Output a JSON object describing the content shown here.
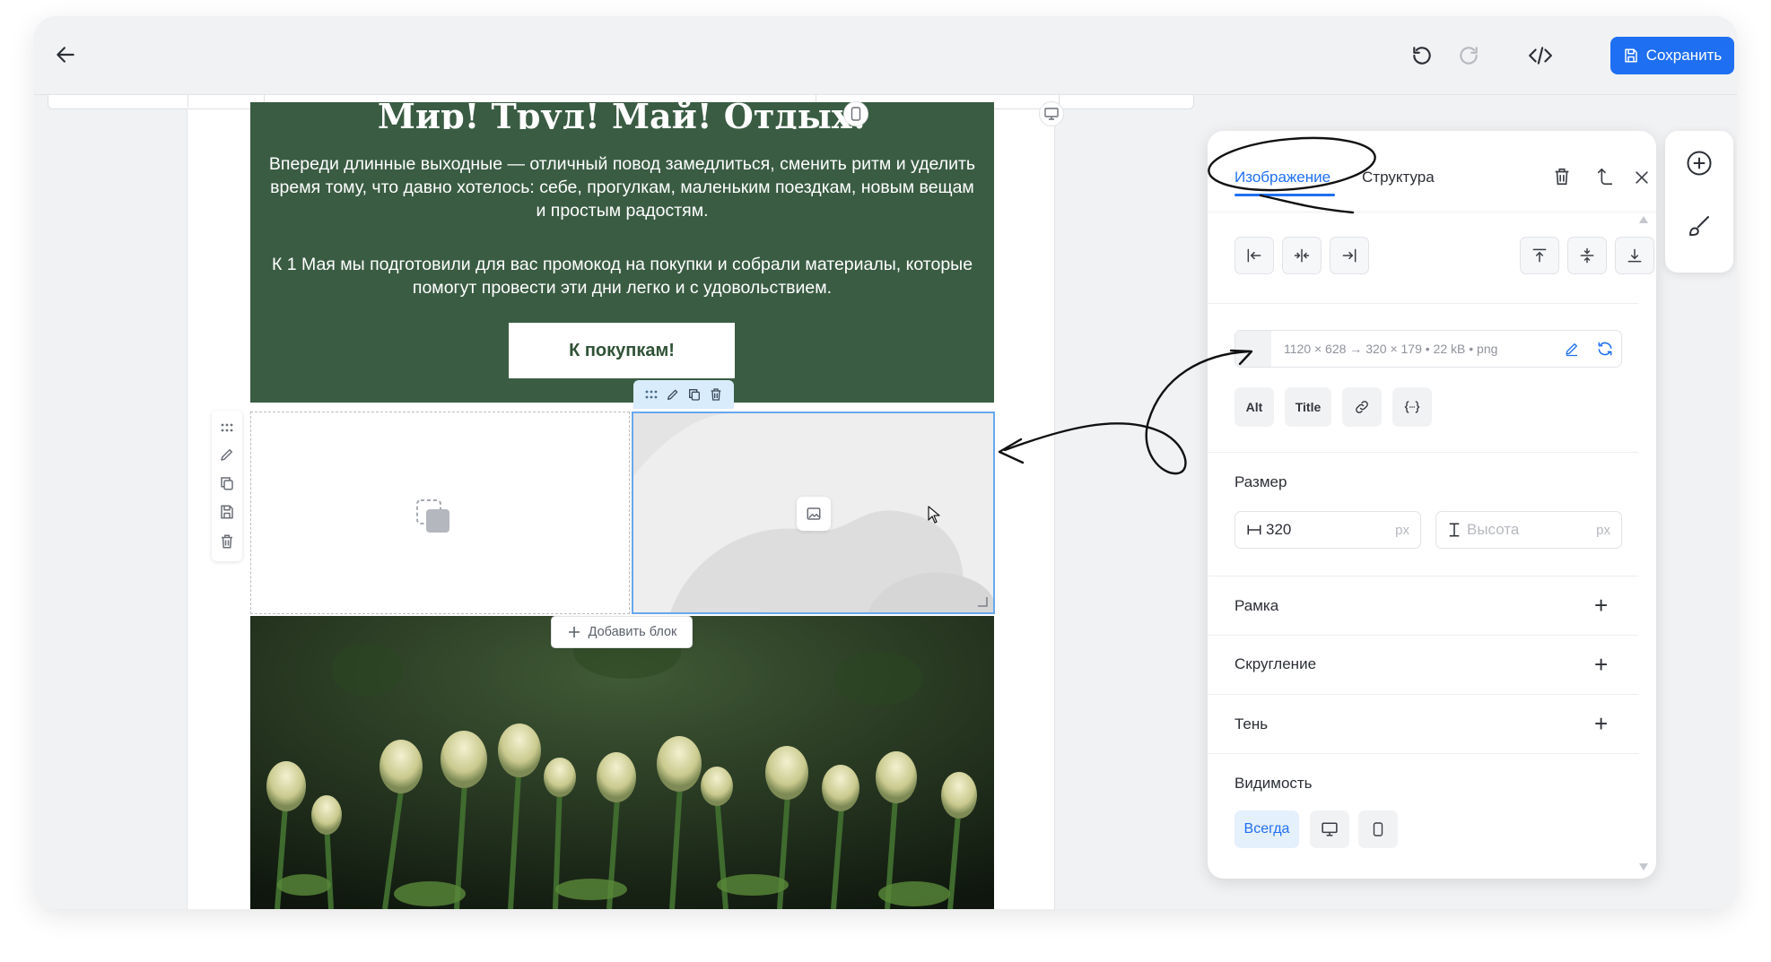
{
  "toolbar": {
    "back_icon": "arrow-left-icon",
    "undo_icon": "undo-icon",
    "redo_icon": "redo-icon",
    "code_icon": "code-icon",
    "save_label": "Сохранить"
  },
  "email": {
    "title": "Мир! Труд! Май! Отдых!",
    "paragraph1": "Впереди длинные выходные — отличный повод замедлиться, сменить ритм и уделить время тому, что давно хотелось: себе, прогулкам, маленьким поездкам, новым вещам и простым радостям.",
    "paragraph2": "К 1 Мая мы подготовили для вас промокод на покупки и собрали материалы, которые помогут провести эти дни легко и с удовольствием.",
    "cta_label": "К покупкам!",
    "add_block_label": "Добавить блок"
  },
  "panel": {
    "tabs": [
      "Изображение",
      "Структура"
    ],
    "active_tab": 0,
    "image_info": "1120 × 628 → 320 × 179 • 22 kB • png",
    "chips": [
      "Alt",
      "Title"
    ],
    "size_label": "Размер",
    "width_value": "320",
    "width_unit": "px",
    "height_placeholder": "Высота",
    "height_unit": "px",
    "sections": [
      "Рамка",
      "Скругление",
      "Тень"
    ],
    "visibility_label": "Видимость",
    "visibility_option": "Всегда"
  },
  "colors": {
    "accent": "#1f6ff2",
    "email_bg": "#3a5c43",
    "selection": "#66a8ef"
  }
}
